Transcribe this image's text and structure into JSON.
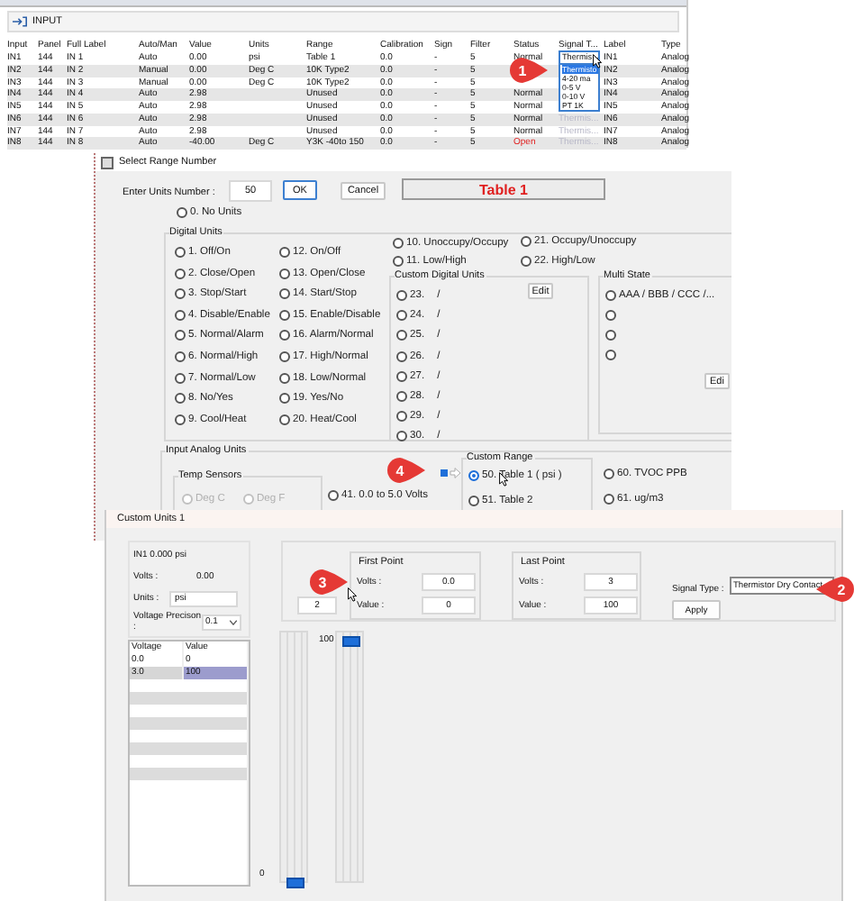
{
  "input_window": {
    "title": "INPUT",
    "columns": [
      {
        "label": "Input"
      },
      {
        "label": "Panel"
      },
      {
        "label": "Full Label"
      },
      {
        "label": "Auto/Man"
      },
      {
        "label": "Value"
      },
      {
        "label": "Units"
      },
      {
        "label": "Range"
      },
      {
        "label": "Calibration"
      },
      {
        "label": "Sign"
      },
      {
        "label": "Filter"
      },
      {
        "label": "Status",
        "kind": "status"
      },
      {
        "label": "Signal T...",
        "kind": "combo"
      },
      {
        "label": "Label"
      },
      {
        "label": "Type"
      }
    ],
    "rows": [
      {
        "alarm": false,
        "cells": [
          "IN1",
          "144",
          "IN 1",
          "Auto",
          "0.00",
          "psi",
          "Table 1",
          "0.0",
          "-",
          "5",
          "Normal",
          null,
          "IN1",
          "Analog"
        ]
      },
      {
        "cells": [
          "IN2",
          "144",
          "IN 2",
          "Manual",
          "0.00",
          "Deg C",
          "10K Type2",
          "0.0",
          "-",
          "5",
          null,
          null,
          "IN2",
          "Analog"
        ]
      },
      {
        "cells": [
          "IN3",
          "144",
          "IN 3",
          "Manual",
          "0.00",
          "Deg C",
          "10K Type2",
          "0.0",
          "-",
          "5",
          null,
          null,
          "IN3",
          "Analog"
        ]
      },
      {
        "alarm": false,
        "cells": [
          "IN4",
          "144",
          "IN 4",
          "Auto",
          "2.98",
          null,
          "Unused",
          "0.0",
          "-",
          "5",
          "Normal",
          null,
          "IN4",
          "Analog"
        ]
      },
      {
        "alarm": false,
        "cells": [
          "IN5",
          "144",
          "IN 5",
          "Auto",
          "2.98",
          null,
          "Unused",
          "0.0",
          "-",
          "5",
          "Normal",
          null,
          "IN5",
          "Analog"
        ]
      },
      {
        "alarm": false,
        "cells": [
          "IN6",
          "144",
          "IN 6",
          "Auto",
          "2.98",
          null,
          "Unused",
          "0.0",
          "-",
          "5",
          "Normal",
          "Thermis...",
          "IN6",
          "Analog"
        ]
      },
      {
        "alarm": false,
        "cells": [
          "IN7",
          "144",
          "IN 7",
          "Auto",
          "2.98",
          null,
          "Unused",
          "0.0",
          "-",
          "5",
          "Normal",
          "Thermis...",
          "IN7",
          "Analog"
        ]
      },
      {
        "alarm": true,
        "cells": [
          "IN8",
          "144",
          "IN 8",
          "Auto",
          "-40.00",
          "Deg C",
          "Y3K -40to 150",
          "0.0",
          "-",
          "5",
          "Open",
          "Thermis...",
          "IN8",
          "Analog"
        ]
      }
    ],
    "dropdown": {
      "value": "Thermis",
      "options": [
        {
          "label": "Thermisto",
          "selected": true
        },
        {
          "label": "4-20 ma",
          "selected": false
        },
        {
          "label": "0-5 V",
          "selected": false
        },
        {
          "label": "0-10 V",
          "selected": false
        },
        {
          "label": "PT 1K",
          "selected": false
        }
      ]
    }
  },
  "range_window": {
    "title": "Select Range Number",
    "units_label": "Enter Units Number :",
    "units_value": "50",
    "ok": "OK",
    "cancel": "Cancel",
    "display": "Table 1",
    "no_units": {
      "label": "0. No Units",
      "selected": false
    },
    "digital": {
      "title": "Digital Units",
      "column_1": [
        {
          "label": "1. Off/On",
          "selected": false
        },
        {
          "label": "2. Close/Open",
          "selected": false
        },
        {
          "label": "3. Stop/Start",
          "selected": false
        },
        {
          "label": "4. Disable/Enable",
          "selected": false
        },
        {
          "label": "5. Normal/Alarm",
          "selected": false
        },
        {
          "label": "6. Normal/High",
          "selected": false
        },
        {
          "label": "7. Normal/Low",
          "selected": false
        },
        {
          "label": "8. No/Yes",
          "selected": false
        },
        {
          "label": "9. Cool/Heat",
          "selected": false
        }
      ],
      "column_2": [
        {
          "label": "12. On/Off",
          "selected": false
        },
        {
          "label": "13. Open/Close",
          "selected": false
        },
        {
          "label": "14. Start/Stop",
          "selected": false
        },
        {
          "label": "15. Enable/Disable",
          "selected": false
        },
        {
          "label": "16. Alarm/Normal",
          "selected": false
        },
        {
          "label": "17. High/Normal",
          "selected": false
        },
        {
          "label": "18. Low/Normal",
          "selected": false
        },
        {
          "label": "19. Yes/No",
          "selected": false
        },
        {
          "label": "20. Heat/Cool",
          "selected": false
        }
      ],
      "column_3": [
        {
          "label": "10. Unoccupy/Occupy",
          "selected": false
        },
        {
          "label": "11. Low/High",
          "selected": false
        }
      ],
      "column_4": [
        {
          "label": "21. Occupy/Unoccupy",
          "selected": false
        },
        {
          "label": "22. High/Low",
          "selected": false
        }
      ]
    },
    "custom_digital": {
      "title": "Custom Digital Units",
      "edit": "Edit",
      "items": [
        {
          "number": "23.",
          "label": "/",
          "selected": false
        },
        {
          "number": "24.",
          "label": "/",
          "selected": false
        },
        {
          "number": "25.",
          "label": "/",
          "selected": false
        },
        {
          "number": "26.",
          "label": "/",
          "selected": false
        },
        {
          "number": "27.",
          "label": "/",
          "selected": false
        },
        {
          "number": "28.",
          "label": "/",
          "selected": false
        },
        {
          "number": "29.",
          "label": "/",
          "selected": false
        },
        {
          "number": "30.",
          "label": "/",
          "selected": false
        }
      ]
    },
    "multi_state": {
      "title": "Multi State",
      "edit": "Edi",
      "items": [
        {
          "label": "AAA / BBB / CCC /...",
          "selected": false
        },
        {
          "selected": false
        },
        {
          "selected": false
        },
        {
          "selected": false
        }
      ]
    },
    "analog": {
      "title": "Input Analog Units",
      "temp_title": "Temp Sensors",
      "temp_items": [
        {
          "label": "Deg C",
          "selected": false,
          "disabled": true
        },
        {
          "label": "Deg F",
          "selected": false,
          "disabled": true
        }
      ],
      "volts": {
        "label": "41.  0.0 to 5.0 Volts",
        "selected": false
      },
      "custom_range_title": "Custom Range",
      "custom_range": [
        {
          "label": "50.  Table 1 ( psi )",
          "selected": true
        },
        {
          "label": "51.  Table 2",
          "selected": false
        }
      ],
      "other": [
        {
          "label": "60.  TVOC  PPB",
          "selected": false
        },
        {
          "label": "61.  ug/m3",
          "selected": false
        }
      ]
    }
  },
  "custom_window": {
    "title": "Custom Units 1",
    "point_label": "IN1  0.000  psi",
    "volts_label": "Volts :",
    "volts_value": "0.00",
    "units_label": "Units :",
    "units_value": "psi",
    "precision_label": "Voltage Precison :",
    "precision_value": "0.1",
    "table": {
      "columns": [
        "Voltage",
        "Value"
      ],
      "rows": [
        {
          "cells": [
            "0.0",
            "0"
          ],
          "selected": false
        },
        {
          "cells": [
            "3.0",
            "100"
          ],
          "selected": true
        }
      ]
    },
    "zero_label": "0",
    "index_value": "2",
    "first_point": {
      "title": "First Point",
      "volts_label": "Volts :",
      "volts": "0.0",
      "value_label": "Value :",
      "value": "0"
    },
    "last_point": {
      "title": "Last Point",
      "volts_label": "Volts :",
      "volts": "3",
      "value_label": "Value :",
      "value": "100"
    },
    "signal_type_label": "Signal Type :",
    "signal_type": "Thermistor Dry Contact",
    "apply": "Apply",
    "slider_label": "100",
    "sliders": [
      {
        "level": 0
      },
      {
        "level": 1
      }
    ]
  },
  "badges": [
    {
      "text": "1",
      "kind": "right"
    },
    {
      "text": "4",
      "kind": "right"
    },
    {
      "text": "3",
      "kind": "right"
    },
    {
      "text": "2",
      "kind": "left"
    }
  ]
}
